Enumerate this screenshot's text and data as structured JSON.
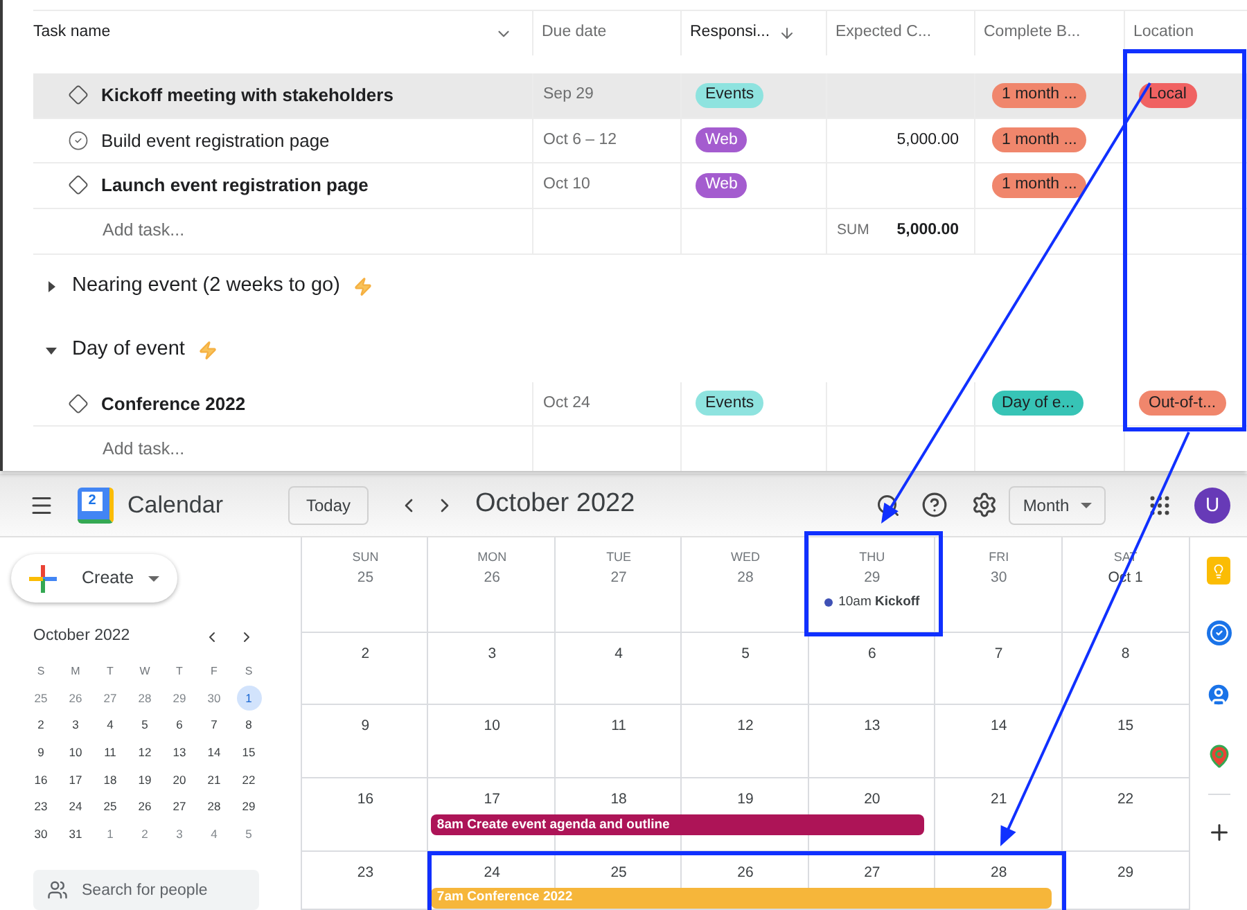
{
  "task_list": {
    "columns": [
      {
        "label": "Task name",
        "kind": "name",
        "sorted": false
      },
      {
        "label": "Due date",
        "kind": "field",
        "sorted": false
      },
      {
        "label": "Responsi...",
        "kind": "field",
        "sorted": true
      },
      {
        "label": "Expected C...",
        "kind": "field",
        "sorted": false
      },
      {
        "label": "Complete B...",
        "kind": "field",
        "sorted": false
      },
      {
        "label": "Location",
        "kind": "field",
        "sorted": false
      }
    ],
    "groups": [
      {
        "tasks": [
          {
            "name": "Kickoff meeting with stakeholders",
            "kind": "milestone",
            "hovered": true,
            "due": "Sep 29",
            "responsible": {
              "label": "Events",
              "color": "#8ee3df"
            },
            "complete_by": {
              "label": "1 month ...",
              "color": "#f0866c"
            },
            "location": {
              "label": "Local",
              "color": "#f06262"
            }
          },
          {
            "name": "Build event registration page",
            "kind": "task",
            "hovered": false,
            "due": "Oct 6 – 12",
            "responsible": {
              "label": "Web",
              "color": "#a45ccf"
            },
            "expected_cost": "5,000.00",
            "complete_by": {
              "label": "1 month ...",
              "color": "#f0866c"
            }
          },
          {
            "name": "Launch event registration page",
            "kind": "milestone",
            "hovered": false,
            "due": "Oct 10",
            "responsible": {
              "label": "Web",
              "color": "#a45ccf"
            },
            "complete_by": {
              "label": "1 month ...",
              "color": "#f0866c"
            }
          }
        ],
        "add_task": "Add task...",
        "sum_label": "SUM",
        "sum_value": "5,000.00"
      },
      {
        "title": "Nearing event (2 weeks to go)",
        "expanded": false
      },
      {
        "title": "Day of event",
        "expanded": true,
        "tasks": [
          {
            "name": "Conference 2022",
            "kind": "milestone",
            "hovered": false,
            "due": "Oct 24",
            "responsible": {
              "label": "Events",
              "color": "#8ee3df"
            },
            "complete_by": {
              "label": "Day of e...",
              "color": "#37c4b6"
            },
            "location": {
              "label": "Out-of-t...",
              "color": "#f0866c"
            }
          }
        ],
        "add_task": "Add task..."
      }
    ]
  },
  "calendar": {
    "app_name": "Calendar",
    "logo_text": "2",
    "today_button": "Today",
    "month_title": "October 2022",
    "view_button": "Month",
    "avatar_initial": "U",
    "create_button": "Create",
    "mini_calendar": {
      "title": "October 2022",
      "weekdays": [
        "S",
        "M",
        "T",
        "W",
        "T",
        "F",
        "S"
      ],
      "days": [
        {
          "label": "25",
          "in_month": false,
          "selected": false
        },
        {
          "label": "26",
          "in_month": false,
          "selected": false
        },
        {
          "label": "27",
          "in_month": false,
          "selected": false
        },
        {
          "label": "28",
          "in_month": false,
          "selected": false
        },
        {
          "label": "29",
          "in_month": false,
          "selected": false
        },
        {
          "label": "30",
          "in_month": false,
          "selected": false
        },
        {
          "label": "1",
          "in_month": true,
          "selected": true
        },
        {
          "label": "2",
          "in_month": true,
          "selected": false
        },
        {
          "label": "3",
          "in_month": true,
          "selected": false
        },
        {
          "label": "4",
          "in_month": true,
          "selected": false
        },
        {
          "label": "5",
          "in_month": true,
          "selected": false
        },
        {
          "label": "6",
          "in_month": true,
          "selected": false
        },
        {
          "label": "7",
          "in_month": true,
          "selected": false
        },
        {
          "label": "8",
          "in_month": true,
          "selected": false
        },
        {
          "label": "9",
          "in_month": true,
          "selected": false
        },
        {
          "label": "10",
          "in_month": true,
          "selected": false
        },
        {
          "label": "11",
          "in_month": true,
          "selected": false
        },
        {
          "label": "12",
          "in_month": true,
          "selected": false
        },
        {
          "label": "13",
          "in_month": true,
          "selected": false
        },
        {
          "label": "14",
          "in_month": true,
          "selected": false
        },
        {
          "label": "15",
          "in_month": true,
          "selected": false
        },
        {
          "label": "16",
          "in_month": true,
          "selected": false
        },
        {
          "label": "17",
          "in_month": true,
          "selected": false
        },
        {
          "label": "18",
          "in_month": true,
          "selected": false
        },
        {
          "label": "19",
          "in_month": true,
          "selected": false
        },
        {
          "label": "20",
          "in_month": true,
          "selected": false
        },
        {
          "label": "21",
          "in_month": true,
          "selected": false
        },
        {
          "label": "22",
          "in_month": true,
          "selected": false
        },
        {
          "label": "23",
          "in_month": true,
          "selected": false
        },
        {
          "label": "24",
          "in_month": true,
          "selected": false
        },
        {
          "label": "25",
          "in_month": true,
          "selected": false
        },
        {
          "label": "26",
          "in_month": true,
          "selected": false
        },
        {
          "label": "27",
          "in_month": true,
          "selected": false
        },
        {
          "label": "28",
          "in_month": true,
          "selected": false
        },
        {
          "label": "29",
          "in_month": true,
          "selected": false
        },
        {
          "label": "30",
          "in_month": true,
          "selected": false
        },
        {
          "label": "31",
          "in_month": true,
          "selected": false
        },
        {
          "label": "1",
          "in_month": false,
          "selected": false
        },
        {
          "label": "2",
          "in_month": false,
          "selected": false
        },
        {
          "label": "3",
          "in_month": false,
          "selected": false
        },
        {
          "label": "4",
          "in_month": false,
          "selected": false
        },
        {
          "label": "5",
          "in_month": false,
          "selected": false
        }
      ]
    },
    "search_placeholder": "Search for people",
    "weekdays": [
      "SUN",
      "MON",
      "TUE",
      "WED",
      "THU",
      "FRI",
      "SAT"
    ],
    "weeks": [
      {
        "days": [
          {
            "label": "25",
            "in_month": false
          },
          {
            "label": "26",
            "in_month": false
          },
          {
            "label": "27",
            "in_month": false
          },
          {
            "label": "28",
            "in_month": false
          },
          {
            "label": "29",
            "in_month": false,
            "events": [
              {
                "kind": "dot",
                "text": "10am **Kickoff**",
                "color": "#3f51b5"
              }
            ]
          },
          {
            "label": "30",
            "in_month": false
          },
          {
            "label": "Oct 1",
            "in_month": true
          }
        ]
      },
      {
        "days": [
          {
            "label": "2",
            "in_month": true
          },
          {
            "label": "3",
            "in_month": true
          },
          {
            "label": "4",
            "in_month": true
          },
          {
            "label": "5",
            "in_month": true
          },
          {
            "label": "6",
            "in_month": true
          },
          {
            "label": "7",
            "in_month": true
          },
          {
            "label": "8",
            "in_month": true
          }
        ]
      },
      {
        "days": [
          {
            "label": "9",
            "in_month": true
          },
          {
            "label": "10",
            "in_month": true
          },
          {
            "label": "11",
            "in_month": true
          },
          {
            "label": "12",
            "in_month": true
          },
          {
            "label": "13",
            "in_month": true
          },
          {
            "label": "14",
            "in_month": true
          },
          {
            "label": "15",
            "in_month": true
          }
        ]
      },
      {
        "days": [
          {
            "label": "16",
            "in_month": true
          },
          {
            "label": "17",
            "in_month": true,
            "events": [
              {
                "kind": "bar",
                "text": "8am Create event agenda and outline",
                "color": "#ad1457"
              }
            ]
          },
          {
            "label": "18",
            "in_month": true,
            "bar_continues": true
          },
          {
            "label": "19",
            "in_month": true,
            "bar_continues": true
          },
          {
            "label": "20",
            "in_month": true,
            "bar_continues": true
          },
          {
            "label": "21",
            "in_month": true
          },
          {
            "label": "22",
            "in_month": true
          }
        ]
      },
      {
        "days": [
          {
            "label": "23",
            "in_month": true
          },
          {
            "label": "24",
            "in_month": true,
            "events": [
              {
                "kind": "bar",
                "text": "7am Conference 2022",
                "color": "#f6b63a"
              }
            ]
          },
          {
            "label": "25",
            "in_month": true,
            "bar_continues": true
          },
          {
            "label": "26",
            "in_month": true,
            "bar_continues": true
          },
          {
            "label": "27",
            "in_month": true,
            "bar_continues": true
          },
          {
            "label": "28",
            "in_month": true,
            "bar_continues": true
          },
          {
            "label": "29",
            "in_month": true
          }
        ]
      }
    ]
  }
}
